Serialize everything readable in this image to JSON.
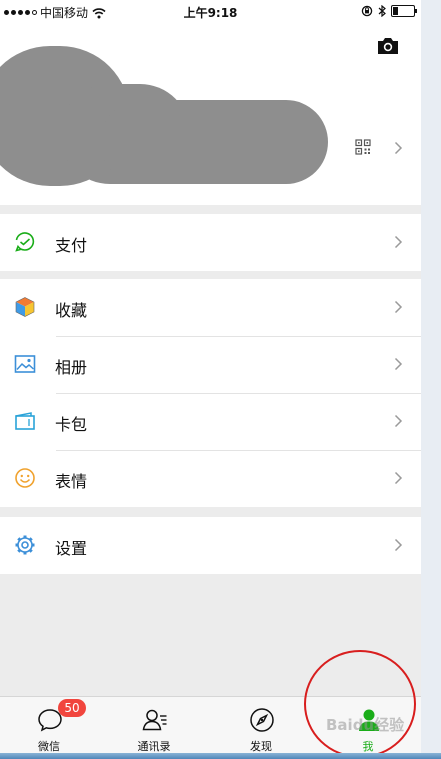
{
  "status_bar": {
    "carrier": "中国移动",
    "time": "上午9:18",
    "battery_level": 0.25
  },
  "menu": {
    "pay": {
      "label": "支付",
      "icon": "wallet-icon"
    },
    "favorites": {
      "label": "收藏",
      "icon": "cube-icon"
    },
    "album": {
      "label": "相册",
      "icon": "image-icon"
    },
    "cards": {
      "label": "卡包",
      "icon": "card-icon"
    },
    "stickers": {
      "label": "表情",
      "icon": "smiley-icon"
    },
    "settings": {
      "label": "设置",
      "icon": "gear-icon"
    }
  },
  "tabs": [
    {
      "label": "微信",
      "icon": "chat-bubble-icon",
      "badge": "50"
    },
    {
      "label": "通讯录",
      "icon": "contacts-icon"
    },
    {
      "label": "发现",
      "icon": "compass-icon"
    },
    {
      "label": "我",
      "icon": "profile-icon",
      "active": true
    }
  ],
  "watermark": "Baidu经验",
  "colors": {
    "accent_green": "#1aad19",
    "badge_red": "#f1453d",
    "annotation_red": "#d81e1e",
    "background": "#ececec"
  }
}
